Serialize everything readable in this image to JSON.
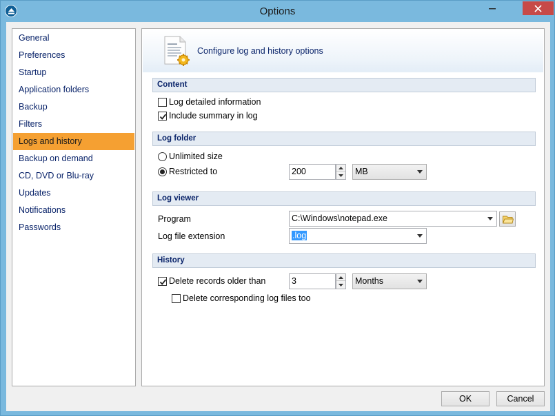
{
  "window": {
    "title": "Options",
    "minimize_icon": "minimize-icon",
    "close_icon": "close-icon"
  },
  "sidebar": {
    "items": [
      {
        "label": "General"
      },
      {
        "label": "Preferences"
      },
      {
        "label": "Startup"
      },
      {
        "label": "Application folders"
      },
      {
        "label": "Backup"
      },
      {
        "label": "Filters"
      },
      {
        "label": "Logs and history",
        "selected": true
      },
      {
        "label": "Backup on demand"
      },
      {
        "label": "CD, DVD or Blu-ray"
      },
      {
        "label": "Updates"
      },
      {
        "label": "Notifications"
      },
      {
        "label": "Passwords"
      }
    ],
    "selected_color": "#f5a032"
  },
  "header": {
    "title": "Configure log and history options",
    "icon": "log-file-gear-icon"
  },
  "content": {
    "heading": "Content",
    "log_detailed": {
      "label": "Log detailed information",
      "checked": false
    },
    "include_summary": {
      "label": "Include summary in log",
      "checked": true
    }
  },
  "log_folder": {
    "heading": "Log folder",
    "unlimited": {
      "label": "Unlimited size",
      "selected": false
    },
    "restricted": {
      "label": "Restricted to",
      "selected": true
    },
    "size_value": "200",
    "unit": "MB"
  },
  "log_viewer": {
    "heading": "Log viewer",
    "program_label": "Program",
    "program_value": "C:\\Windows\\notepad.exe",
    "extension_label": "Log file extension",
    "extension_value": ".log"
  },
  "history": {
    "heading": "History",
    "delete_older": {
      "label": "Delete records older than",
      "checked": true
    },
    "age_value": "3",
    "age_unit": "Months",
    "delete_logs": {
      "label": "Delete corresponding log files too",
      "checked": false
    }
  },
  "buttons": {
    "ok": "OK",
    "cancel": "Cancel"
  },
  "colors": {
    "title_bar": "#7ab9de",
    "close_button": "#c74a48",
    "section_header": "#e4ebf3",
    "link_text": "#0a246a"
  }
}
